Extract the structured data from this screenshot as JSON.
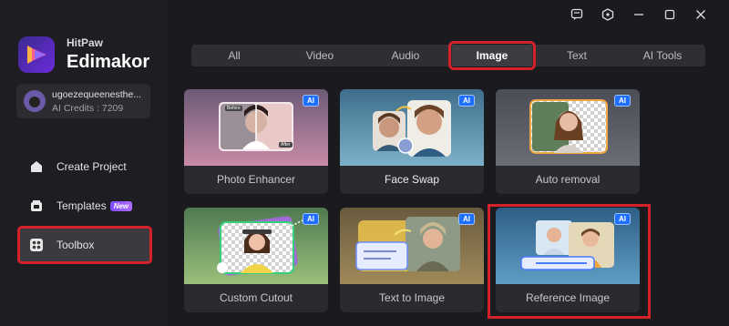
{
  "brand": {
    "sub": "HitPaw",
    "main": "Edimakor"
  },
  "account": {
    "name": "ugoezequeenesthe...",
    "credits": "AI Credits : 7209"
  },
  "nav": [
    {
      "label": "Create Project",
      "icon": "create-project-icon"
    },
    {
      "label": "Templates",
      "icon": "templates-icon",
      "badge": "New"
    },
    {
      "label": "Toolbox",
      "icon": "toolbox-icon",
      "active": true
    }
  ],
  "tabs": [
    {
      "label": "All"
    },
    {
      "label": "Video"
    },
    {
      "label": "Audio"
    },
    {
      "label": "Image",
      "active": true
    },
    {
      "label": "Text"
    },
    {
      "label": "AI Tools"
    }
  ],
  "tools": [
    {
      "label": "Photo Enhancer",
      "badge": "AI"
    },
    {
      "label": "Face Swap",
      "badge": "AI"
    },
    {
      "label": "Auto removal",
      "badge": "AI"
    },
    {
      "label": "Custom Cutout",
      "badge": "AI"
    },
    {
      "label": "Text to Image",
      "badge": "AI"
    },
    {
      "label": "Reference Image",
      "badge": "AI"
    }
  ],
  "thumb_text": {
    "before": "Before",
    "after": "After"
  },
  "colors": {
    "highlight": "#d3222a",
    "ai_badge": "#1f6fff",
    "accent": "#6a2bd9"
  }
}
